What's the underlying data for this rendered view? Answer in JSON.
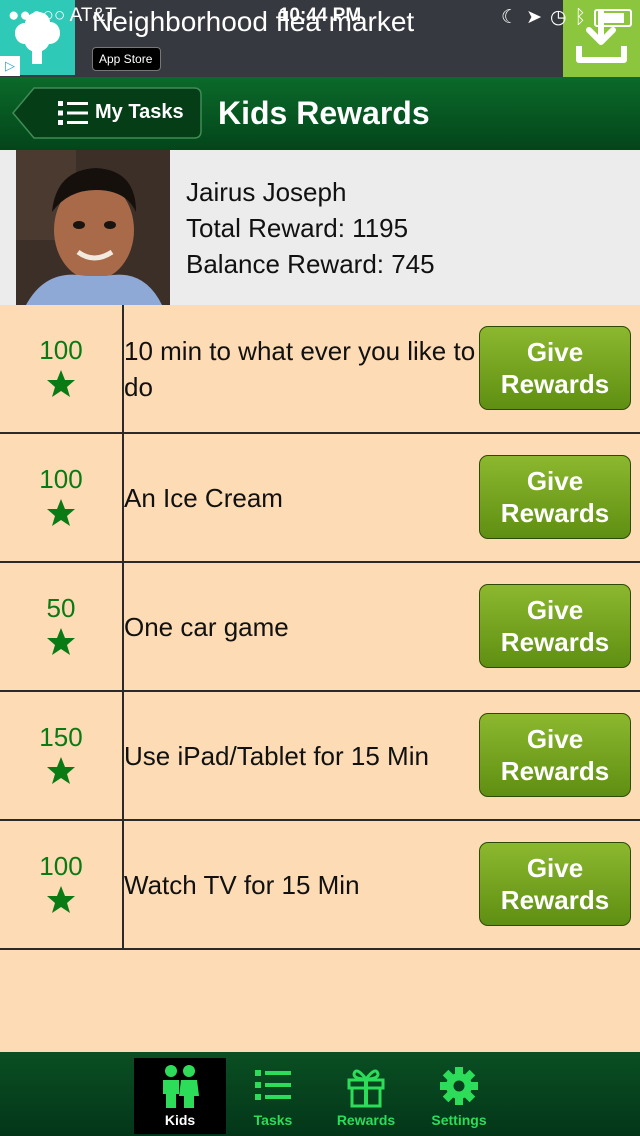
{
  "status_bar": {
    "carrier": "●●○○○ AT&T",
    "time": "10:44 PM"
  },
  "ad": {
    "title": "Neighborhood flea market",
    "store_badge": "App Store"
  },
  "navbar": {
    "back_label": "My Tasks",
    "title": "Kids Rewards"
  },
  "kid": {
    "name": "Jairus Joseph",
    "total_reward": "Total Reward: 1195",
    "balance_reward": "Balance Reward: 745"
  },
  "rewards": [
    {
      "points": "100",
      "title": "10 min to what ever you like to do",
      "button": "Give Rewards"
    },
    {
      "points": "100",
      "title": "An Ice Cream",
      "button": "Give Rewards"
    },
    {
      "points": "50",
      "title": "One car game",
      "button": "Give Rewards"
    },
    {
      "points": "150",
      "title": "Use iPad/Tablet for 15 Min",
      "button": "Give Rewards"
    },
    {
      "points": "100",
      "title": "Watch TV for 15 Min",
      "button": "Give Rewards"
    }
  ],
  "tabs": [
    {
      "label": "Kids",
      "icon": "kids-icon",
      "active": true
    },
    {
      "label": "Tasks",
      "icon": "list-icon",
      "active": false
    },
    {
      "label": "Rewards",
      "icon": "gift-icon",
      "active": false
    },
    {
      "label": "Settings",
      "icon": "gear-icon",
      "active": false
    }
  ],
  "colors": {
    "nav_green": "#0b6a2a",
    "list_background": "#fddbb4",
    "points_green": "#0a7a14",
    "button_green": "#7aa823",
    "tab_accent": "#2ddc59"
  }
}
